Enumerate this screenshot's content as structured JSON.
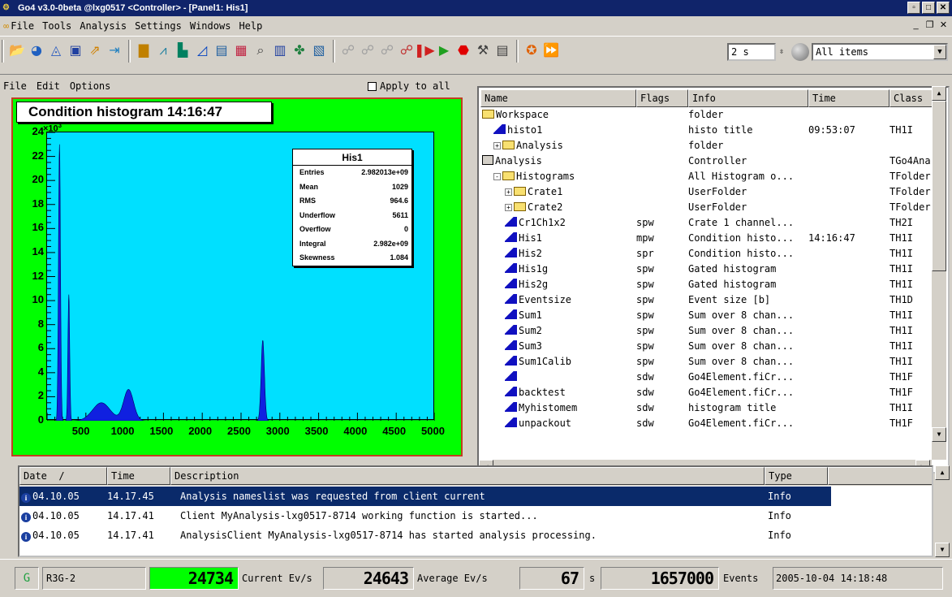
{
  "window": {
    "title": "Go4 v3.0-0beta @lxg0517 <Controller> - [Panel1: His1]"
  },
  "menu": [
    "File",
    "Tools",
    "Analysis",
    "Settings",
    "Windows",
    "Help"
  ],
  "toolbar": {
    "update_interval": "2 s",
    "filter": "All items"
  },
  "panel": {
    "menu": [
      "File",
      "Edit",
      "Options"
    ],
    "apply_all": "Apply to all",
    "condition_title": "Condition histogram  14:16:47"
  },
  "stats": {
    "title": "His1",
    "rows": [
      {
        "k": "Entries",
        "v": "2.982013e+09"
      },
      {
        "k": "Mean",
        "v": "1029"
      },
      {
        "k": "RMS",
        "v": "964.6"
      },
      {
        "k": "Underflow",
        "v": "5611"
      },
      {
        "k": "Overflow",
        "v": "0"
      },
      {
        "k": "Integral",
        "v": "2.982e+09"
      },
      {
        "k": "Skewness",
        "v": "1.084"
      }
    ]
  },
  "chart_data": {
    "type": "area",
    "xlim": [
      0,
      5000
    ],
    "ylim": [
      0,
      24
    ],
    "y_exponent": "×10",
    "x_ticks": [
      "500",
      "1000",
      "1500",
      "2000",
      "2500",
      "3000",
      "3500",
      "4000",
      "4500",
      "5000"
    ],
    "y_ticks": [
      "0",
      "2",
      "4",
      "6",
      "8",
      "10",
      "12",
      "14",
      "16",
      "18",
      "20",
      "22",
      "24"
    ],
    "peaks": [
      {
        "x": 160,
        "y": 23
      },
      {
        "x": 280,
        "y": 10.5
      },
      {
        "x": 700,
        "y": 1.5
      },
      {
        "x": 1050,
        "y": 2.6
      },
      {
        "x": 2780,
        "y": 6.7
      }
    ]
  },
  "tree": {
    "columns": [
      "Name",
      "Flags",
      "Info",
      "Time",
      "Class"
    ],
    "rows": [
      {
        "indent": 0,
        "icon": "folder",
        "name": "Workspace",
        "flags": "",
        "info": "folder",
        "time": "",
        "cls": ""
      },
      {
        "indent": 1,
        "icon": "histo",
        "name": "histo1",
        "flags": "",
        "info": "histo title",
        "time": "09:53:07",
        "cls": "TH1I"
      },
      {
        "indent": 1,
        "icon": "folder",
        "exp": "+",
        "name": "Analysis",
        "flags": "",
        "info": "folder",
        "time": "",
        "cls": ""
      },
      {
        "indent": 0,
        "icon": "analysis",
        "name": "Analysis",
        "flags": "",
        "info": "Controller",
        "time": "",
        "cls": "TGo4Ana"
      },
      {
        "indent": 1,
        "icon": "folder",
        "exp": "-",
        "name": "Histograms",
        "flags": "",
        "info": "All Histogram o...",
        "time": "",
        "cls": "TFolder"
      },
      {
        "indent": 2,
        "icon": "folder",
        "exp": "+",
        "name": "Crate1",
        "flags": "",
        "info": "UserFolder",
        "time": "",
        "cls": "TFolder"
      },
      {
        "indent": 2,
        "icon": "folder",
        "exp": "+",
        "name": "Crate2",
        "flags": "",
        "info": "UserFolder",
        "time": "",
        "cls": "TFolder"
      },
      {
        "indent": 2,
        "icon": "histo",
        "name": "Cr1Ch1x2",
        "flags": "spw",
        "info": "Crate 1 channel...",
        "time": "",
        "cls": "TH2I"
      },
      {
        "indent": 2,
        "icon": "histo",
        "name": "His1",
        "flags": "mpw",
        "info": "Condition histo...",
        "time": "14:16:47",
        "cls": "TH1I"
      },
      {
        "indent": 2,
        "icon": "histo",
        "name": "His2",
        "flags": "spr",
        "info": "Condition histo...",
        "time": "",
        "cls": "TH1I"
      },
      {
        "indent": 2,
        "icon": "histo",
        "name": "His1g",
        "flags": "spw",
        "info": "Gated histogram",
        "time": "",
        "cls": "TH1I"
      },
      {
        "indent": 2,
        "icon": "histo",
        "name": "His2g",
        "flags": "spw",
        "info": "Gated histogram",
        "time": "",
        "cls": "TH1I"
      },
      {
        "indent": 2,
        "icon": "histo",
        "name": "Eventsize",
        "flags": "spw",
        "info": "Event size [b]",
        "time": "",
        "cls": "TH1D"
      },
      {
        "indent": 2,
        "icon": "histo",
        "name": "Sum1",
        "flags": "spw",
        "info": "Sum over 8 chan...",
        "time": "",
        "cls": "TH1I"
      },
      {
        "indent": 2,
        "icon": "histo",
        "name": "Sum2",
        "flags": "spw",
        "info": "Sum over 8 chan...",
        "time": "",
        "cls": "TH1I"
      },
      {
        "indent": 2,
        "icon": "histo",
        "name": "Sum3",
        "flags": "spw",
        "info": "Sum over 8 chan...",
        "time": "",
        "cls": "TH1I"
      },
      {
        "indent": 2,
        "icon": "histo",
        "name": "Sum1Calib",
        "flags": "spw",
        "info": "Sum over 8 chan...",
        "time": "",
        "cls": "TH1I"
      },
      {
        "indent": 2,
        "icon": "histo",
        "name": "",
        "flags": "sdw",
        "info": "Go4Element.fiCr...",
        "time": "",
        "cls": "TH1F"
      },
      {
        "indent": 2,
        "icon": "histo",
        "name": "backtest",
        "flags": "sdw",
        "info": "Go4Element.fiCr...",
        "time": "",
        "cls": "TH1F"
      },
      {
        "indent": 2,
        "icon": "histo",
        "name": "Myhistomem",
        "flags": "sdw",
        "info": "histogram title",
        "time": "",
        "cls": "TH1I"
      },
      {
        "indent": 2,
        "icon": "histo",
        "name": "unpackout",
        "flags": "sdw",
        "info": "Go4Element.fiCr...",
        "time": "",
        "cls": "TH1F"
      }
    ]
  },
  "log": {
    "columns": [
      "Date",
      "Time",
      "Description",
      "Type"
    ],
    "sort_indicator": "/",
    "rows": [
      {
        "date": "04.10.05",
        "time": "14.17.45",
        "desc": "Analysis nameslist was requested from client current",
        "type": "Info",
        "selected": true
      },
      {
        "date": "04.10.05",
        "time": "14.17.41",
        "desc": "Client MyAnalysis-lxg0517-8714 working function is started...",
        "type": "Info"
      },
      {
        "date": "04.10.05",
        "time": "14.17.41",
        "desc": "AnalysisClient MyAnalysis-lxg0517-8714 has started analysis processing.",
        "type": "Info"
      }
    ]
  },
  "status": {
    "node": "R3G-2",
    "current_rate": "24734",
    "current_label": "Current Ev/s",
    "average_rate": "24643",
    "average_label": "Average Ev/s",
    "time_value": "67",
    "time_unit": "s",
    "events_value": "1657000",
    "events_label": "Events",
    "datetime": "2005-10-04 14:18:48",
    "colors": {
      "current_bg": "#00ff00",
      "lcd_bg": "#d4d0c8"
    }
  }
}
